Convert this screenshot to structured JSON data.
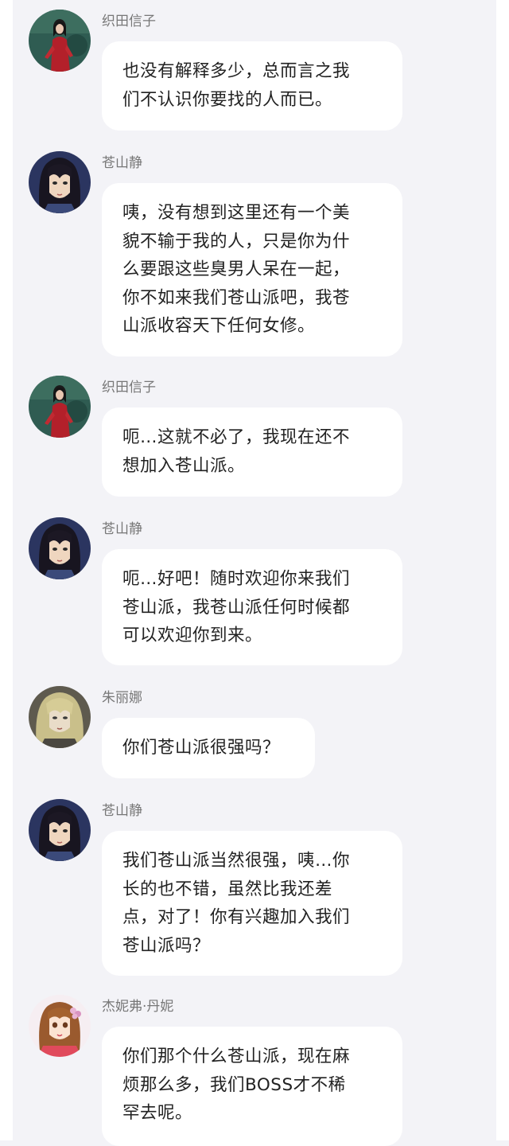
{
  "messages": [
    {
      "sender": "织田信子",
      "avatar_icon": "woman-red-dress-avatar",
      "lines": [
        "也没有解释多少，总而言之我",
        "们不认识你要找的人而已。"
      ]
    },
    {
      "sender": "苍山静",
      "avatar_icon": "anime-long-hair-avatar",
      "lines": [
        "咦，没有想到这里还有一个美",
        "貌不输于我的人，只是你为什",
        "么要跟这些臭男人呆在一起，",
        "你不如来我们苍山派吧，我苍",
        "山派收容天下任何女修。"
      ]
    },
    {
      "sender": "织田信子",
      "avatar_icon": "woman-red-dress-avatar",
      "lines": [
        "呃…这就不必了，我现在还不",
        "想加入苍山派。"
      ]
    },
    {
      "sender": "苍山静",
      "avatar_icon": "anime-long-hair-avatar",
      "lines": [
        "呃…好吧！随时欢迎你来我们",
        "苍山派，我苍山派任何时候都",
        "可以欢迎你到来。"
      ]
    },
    {
      "sender": "朱丽娜",
      "avatar_icon": "anime-blonde-avatar",
      "lines": [
        "你们苍山派很强吗？"
      ]
    },
    {
      "sender": "苍山静",
      "avatar_icon": "anime-long-hair-avatar",
      "lines": [
        "我们苍山派当然很强，咦…你",
        "长的也不错，虽然比我还差",
        "点，对了！你有兴趣加入我们",
        "苍山派吗？"
      ]
    },
    {
      "sender": "杰妮弗·丹妮",
      "avatar_icon": "anime-girl-pink-avatar",
      "lines": [
        "你们那个什么苍山派，现在麻",
        "烦那么多，我们BOSS才不稀",
        "罕去呢。"
      ]
    }
  ],
  "colors": {
    "background": "#f3f3f7",
    "bubble": "#ffffff",
    "text": "#222222",
    "sender": "#777777"
  }
}
